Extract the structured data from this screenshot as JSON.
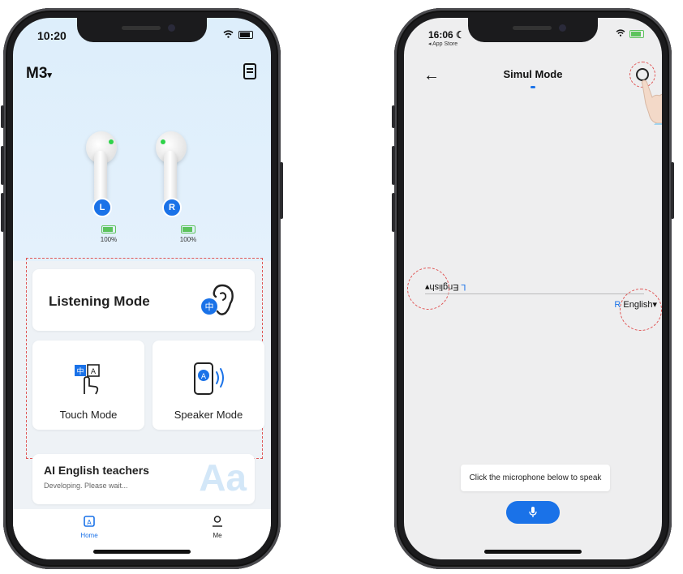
{
  "left_phone": {
    "status": {
      "time": "10:20"
    },
    "header": {
      "device": "M3"
    },
    "earbuds": [
      {
        "side": "L",
        "battery": "100%"
      },
      {
        "side": "R",
        "battery": "100%"
      }
    ],
    "listening_mode": {
      "label": "Listening Mode"
    },
    "touch_mode": {
      "label": "Touch Mode"
    },
    "speaker_mode": {
      "label": "Speaker Mode"
    },
    "ai_teacher": {
      "title": "AI English teachers",
      "subtitle": "Developing. Please wait...",
      "watermark": "Aa"
    },
    "tabs": [
      {
        "label": "Home",
        "active": true
      },
      {
        "label": "Me",
        "active": false
      }
    ],
    "accent_color": "#1a72e8"
  },
  "right_phone": {
    "status": {
      "time": "16:06",
      "back_app": "◂ App Store"
    },
    "title": "Simul Mode",
    "left_lang": {
      "prefix": "L",
      "value": "English"
    },
    "right_lang": {
      "prefix": "R",
      "value": "English"
    },
    "hint": "Click the microphone below to speak",
    "highlight_color": "#e05656"
  }
}
